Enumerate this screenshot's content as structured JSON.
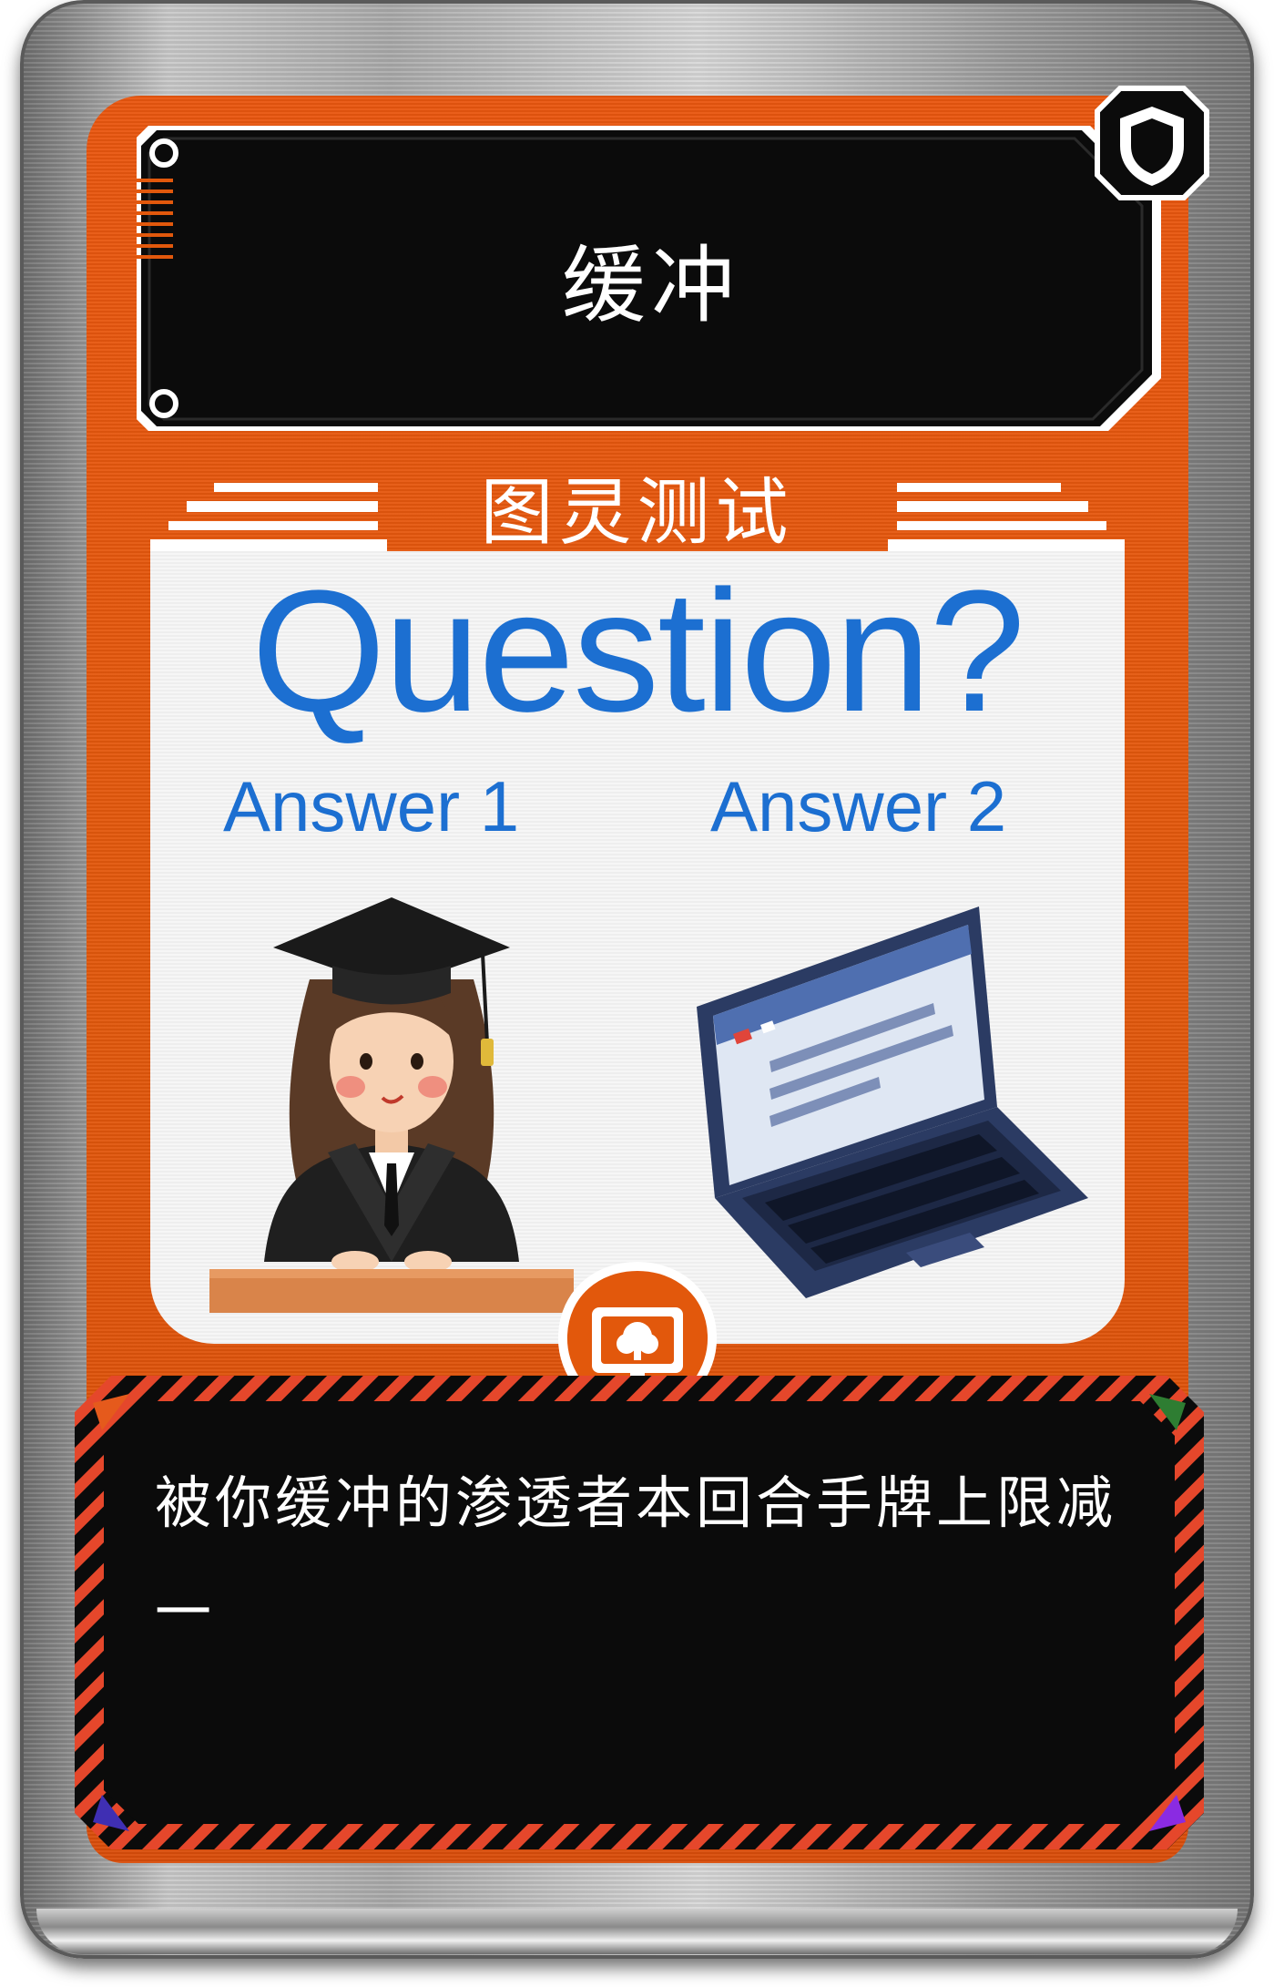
{
  "card": {
    "title": "缓冲",
    "category": "图灵测试",
    "effect": "被你缓冲的渗透者本回合手牌上限减一"
  },
  "art": {
    "question": "Question?",
    "answer_1": "Answer 1",
    "answer_2": "Answer 2"
  },
  "icons": {
    "badge": "shield-icon",
    "emblem": "computer-tree-icon",
    "corner_top_left": "triangle-orange",
    "corner_top_right": "triangle-green",
    "corner_bottom_left": "triangle-blue",
    "corner_bottom_right": "triangle-purple"
  },
  "colors": {
    "panel_orange": "#e2580c",
    "text_blue": "#1c6fd1",
    "plate_black": "#0b0b0b",
    "hazard_red": "#e5472b"
  }
}
